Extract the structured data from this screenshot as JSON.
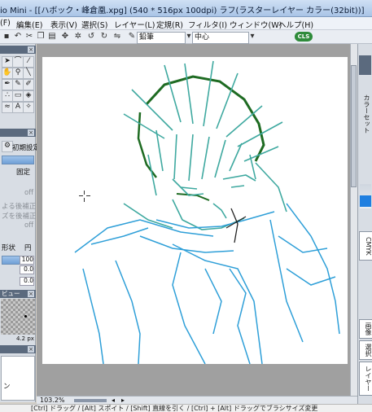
{
  "window": {
    "title": "io Mini - [[ハボック・峰倉凰.xpg] (540 * 516px 100dpi)   ラフ(ラスターレイヤー カラー(32bit))]"
  },
  "menu": {
    "items": [
      "(F)",
      "編集(E)",
      "表示(V)",
      "選択(S)",
      "レイヤー(L)",
      "定規(R)",
      "フィルタ(I)",
      "ウィンドウ(W)",
      "ヘルプ(H)"
    ]
  },
  "toolbar": {
    "brush_select": "鉛筆",
    "center_select": "中心",
    "cls_badge": "CLS"
  },
  "tool_panel": {
    "icons": [
      "arrow-tool-icon",
      "lasso-tool-icon",
      "magic-wand-icon",
      "eyedropper-icon",
      "hand-tool-icon",
      "zoom-tool-icon",
      "pen-tool-icon",
      "pencil-tool-icon",
      "line-tool-icon",
      "brush-tool-icon",
      "airbrush-tool-icon",
      "eraser-tool-icon",
      "fill-tool-icon",
      "blend-tool-icon",
      "text-tool-icon"
    ]
  },
  "tool_options": {
    "reset_label": "初期設定",
    "fixed_label": "固定",
    "off_label_1": "off",
    "correction_label": "よる後補正",
    "size_correction_label": "ズを後補正",
    "off_label_2": "off",
    "shape_label": "形状",
    "circle_label": "円",
    "value_1": "100",
    "value_2": "0.0",
    "value_3": "0.0"
  },
  "preview_panel": {
    "title": "ビュー",
    "size_label": "4.2 px"
  },
  "layer_panel": {
    "item_label": "ン"
  },
  "status": {
    "zoom": "103.2%"
  },
  "hint": {
    "text": "[Ctrl] ドラッグ / [Alt] スポイト / [Shift] 直線を引く / [Ctrl] + [Alt] ドラッグでブラシサイズ変更"
  },
  "right_panel": {
    "color_label": "カラーセット",
    "cmyk_label": "CMYK",
    "image_label": "画像",
    "select_label": "選択",
    "layer_label": "レイヤー"
  },
  "colors": {
    "accent_green": "#2e8b3a",
    "stroke_teal": "#3fa9a0",
    "stroke_blue": "#2e9fd8",
    "stroke_darkgreen": "#1e6b22",
    "swatch_blue": "#1f7fe0"
  }
}
